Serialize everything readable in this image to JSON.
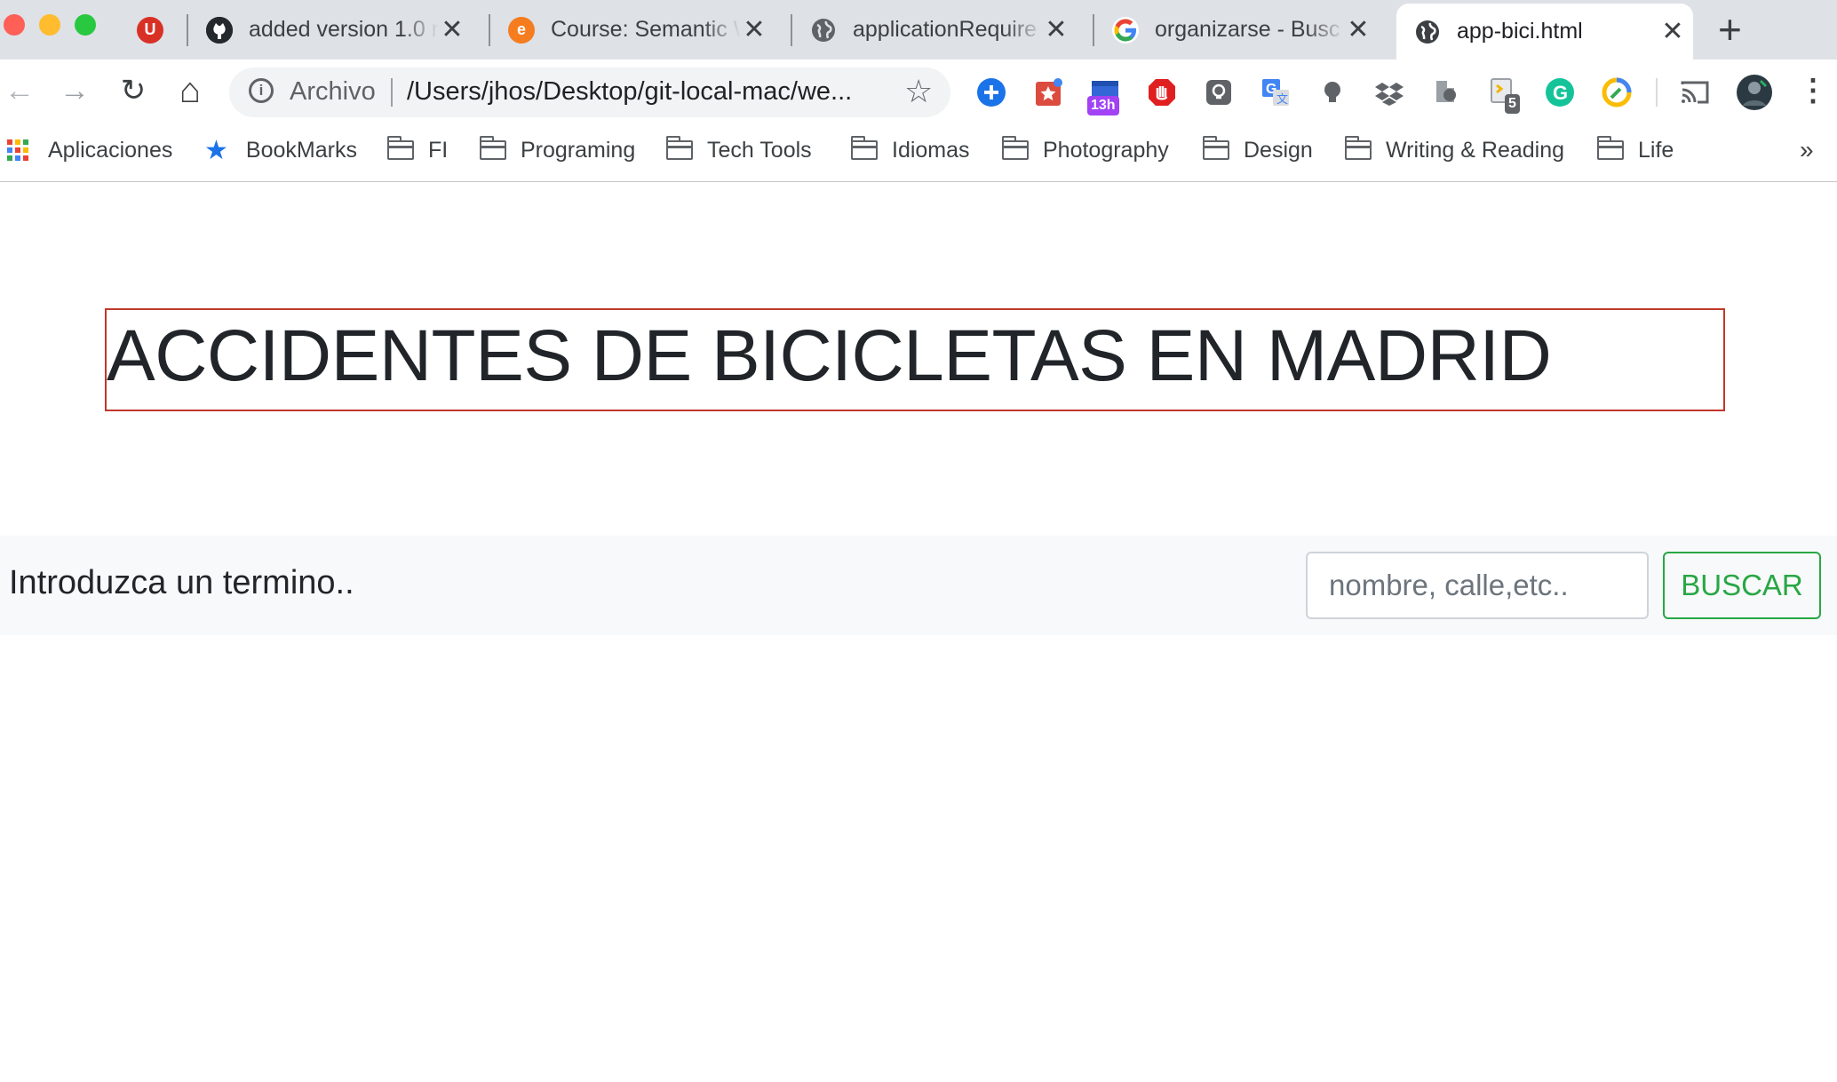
{
  "window": {
    "traffic_lights": [
      {
        "name": "close-window-button",
        "color": "#fe5f57"
      },
      {
        "name": "minimize-window-button",
        "color": "#febc2e"
      },
      {
        "name": "zoom-window-button",
        "color": "#28c840"
      }
    ]
  },
  "tabs": [
    {
      "title": "",
      "icon": "ublock-icon",
      "icon_color": "#d93025",
      "icon_glyph": "U",
      "active": false
    },
    {
      "title": "added version 1.0 r",
      "icon": "github-icon",
      "icon_color": "#24292e",
      "active": false
    },
    {
      "title": "Course: Semantic W",
      "icon": "course-e-icon",
      "icon_color": "#f57c1f",
      "icon_glyph": "e",
      "active": false
    },
    {
      "title": "applicationRequire",
      "icon": "globe-icon",
      "icon_color": "#5f6368",
      "active": false
    },
    {
      "title": "organizarse - Busc",
      "icon": "google-icon",
      "icon_color": "#4285f4",
      "active": false
    },
    {
      "title": "app-bici.html",
      "icon": "globe-icon",
      "icon_color": "#5f6368",
      "active": true
    }
  ],
  "new_tab_label": "+",
  "tab_close_glyph": "✕",
  "toolbar": {
    "back_glyph": "←",
    "forward_glyph": "→",
    "reload_glyph": "↻",
    "home_glyph": "⌂",
    "omnibox_info_glyph": "i",
    "omnibox_label": "Archivo",
    "omnibox_url": "/Users/jhos/Desktop/git-local-mac/we...",
    "bookmark_star_glyph": "☆",
    "menu_glyph": "⋮",
    "extensions": [
      {
        "name": "add-extension-icon",
        "color": "#1a73e8"
      },
      {
        "name": "todoist-extension-icon",
        "color": "#db4c3f"
      },
      {
        "name": "calendar-extension-icon",
        "color": "#3367d6",
        "badge": "13h",
        "badge_color": "#a142f4"
      },
      {
        "name": "adblock-extension-icon",
        "color": "#e02020"
      },
      {
        "name": "lightbulb-extension-icon",
        "color": "#5f6368"
      },
      {
        "name": "google-translate-extension-icon",
        "color": "#4285f4"
      },
      {
        "name": "bulb-extension-icon",
        "color": "#5f6368"
      },
      {
        "name": "dropbox-extension-icon",
        "color": "#5f6368"
      },
      {
        "name": "puzzle-extension-icon",
        "color": "#5f6368"
      },
      {
        "name": "script-extension-icon",
        "color": "#5f6368",
        "badge": "5",
        "badge_color": "#5f6368"
      },
      {
        "name": "grammarly-extension-icon",
        "color": "#15c39a"
      },
      {
        "name": "color-extension-icon",
        "color": "#fbbc05"
      },
      {
        "name": "cast-icon",
        "color": "#5f6368"
      },
      {
        "name": "profile-avatar",
        "color": "#2b3a42"
      }
    ]
  },
  "bookmarks": {
    "apps_label": "Aplicaciones",
    "items": [
      {
        "label": "BookMarks",
        "icon": "star-icon"
      },
      {
        "label": "FI",
        "icon": "folder-icon"
      },
      {
        "label": "Programing",
        "icon": "folder-icon"
      },
      {
        "label": "Tech Tools",
        "icon": "folder-icon"
      },
      {
        "label": "Idiomas",
        "icon": "folder-icon"
      },
      {
        "label": "Photography",
        "icon": "folder-icon"
      },
      {
        "label": "Design",
        "icon": "folder-icon"
      },
      {
        "label": "Writing & Reading",
        "icon": "folder-icon"
      },
      {
        "label": "Life",
        "icon": "folder-icon"
      }
    ],
    "overflow_glyph": "»"
  },
  "page": {
    "heading": "ACCIDENTES DE BICICLETAS EN MADRID",
    "heading_border_color": "#c0392b",
    "search": {
      "prompt": "Introduzca un termino..",
      "placeholder": "nombre, calle,etc..",
      "value": "",
      "button_label": "BUSCAR",
      "button_color": "#28a745"
    }
  }
}
